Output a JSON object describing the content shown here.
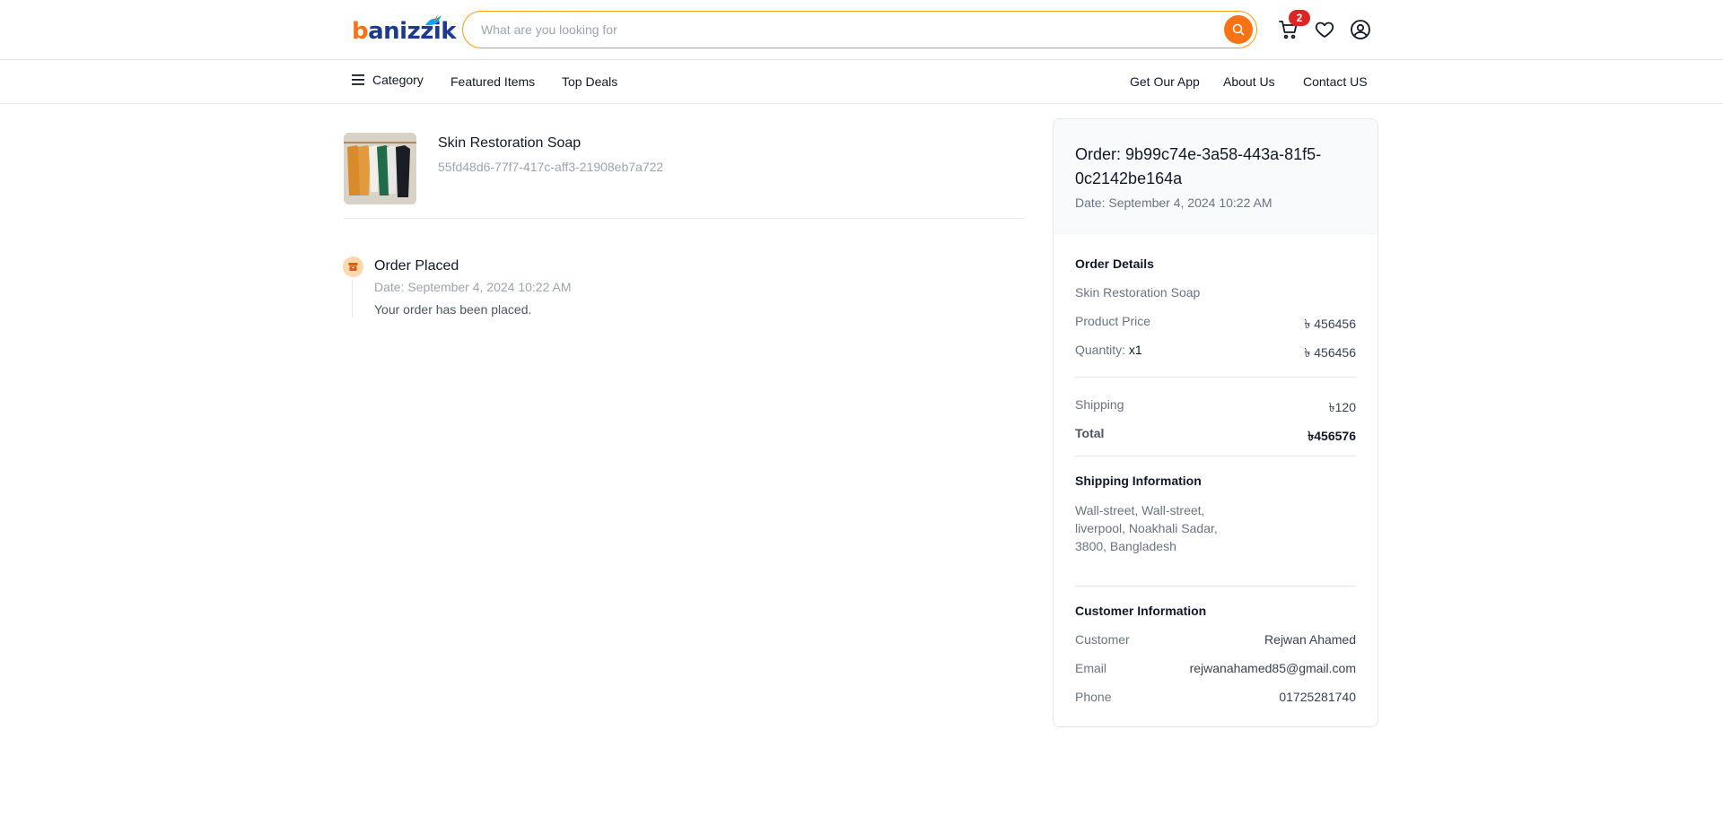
{
  "header": {
    "logo_text": "banizzik",
    "search_placeholder": "What are you looking for",
    "cart_count": "2",
    "accent_color": "#f97316"
  },
  "nav": {
    "left": [
      {
        "label": "Category"
      },
      {
        "label": "Featured Items"
      },
      {
        "label": "Top Deals"
      }
    ],
    "right": [
      {
        "label": "Get Our App"
      },
      {
        "label": "About Us"
      },
      {
        "label": "Contact US"
      }
    ]
  },
  "product": {
    "name": "Skin Restoration Soap",
    "id": "55fd48d6-77f7-417c-aff3-21908eb7a722"
  },
  "timeline": [
    {
      "title": "Order Placed",
      "date": "Date: September 4, 2024 10:22 AM",
      "description": "Your order has been placed."
    }
  ],
  "summary": {
    "order_title": "Order: 9b99c74e-3a58-443a-81f5-0c2142be164a",
    "date": "Date: September 4, 2024 10:22 AM",
    "details_title": "Order Details",
    "item_name": "Skin Restoration Soap",
    "product_price_label": "Product Price",
    "product_price": "৳ 456456",
    "quantity_label": "Quantity:",
    "quantity_value": "x1",
    "quantity_total": "৳ 456456",
    "shipping_label": "Shipping",
    "shipping": "৳120",
    "total_label": "Total",
    "total": "৳456576",
    "shipping_info_title": "Shipping Information",
    "address": "Wall-street, Wall-street, liverpool, Noakhali Sadar, 3800, Bangladesh",
    "customer_info_title": "Customer Information",
    "customer_label": "Customer",
    "customer": "Rejwan Ahamed",
    "email_label": "Email",
    "email": "rejwanahamed85@gmail.com",
    "phone_label": "Phone",
    "phone": "01725281740"
  }
}
